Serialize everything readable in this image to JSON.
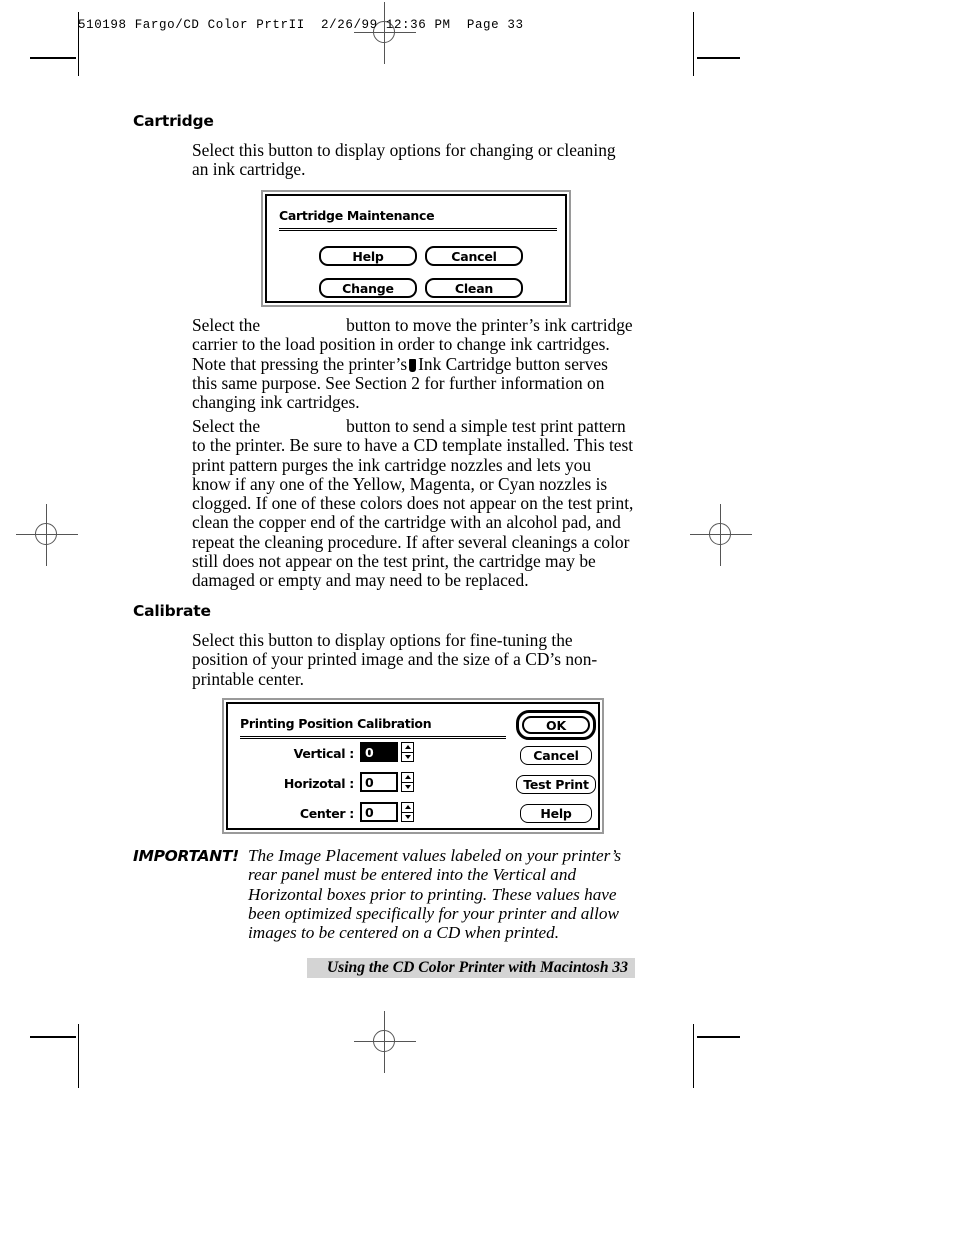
{
  "page_header": {
    "text": "510198 Fargo/CD Color PrtrII  2/26/99 12:36 PM  Page 33"
  },
  "sections": [
    {
      "heading": "Cartridge",
      "intro": "Select this button to display options for changing or cleaning an ink cartridge."
    },
    {
      "heading": "Calibrate",
      "intro": "Select this button to display options for fine-tuning the position of your printed image and the size of a CD’s non-printable center."
    }
  ],
  "paragraphs": {
    "change_para_a": "Select the",
    "change_para_b": "button to move the printer’s ink cartridge carrier to the load position in order to change ink cartridges. Note that pressing the printer’s",
    "change_para_c": "Ink Cartridge button serves this same purpose. See Section 2 for further information on changing ink cartridges.",
    "clean_para_a": "Select the",
    "clean_para_b": "button to send a simple test print pattern to the printer. Be sure to have a CD template installed. This test print pattern purges the ink cartridge nozzles and lets you know if any one of the Yellow, Magenta, or Cyan nozzles is clogged. If one of these colors does not appear on the test print, clean the copper end of the cartridge with an alcohol pad, and repeat the cleaning procedure. If after several cleanings a color still does not appear on the test print, the cartridge may be damaged or empty and may need to be replaced."
  },
  "cartridge_dialog": {
    "title": "Cartridge Maintenance",
    "buttons": [
      {
        "label": "Help"
      },
      {
        "label": "Cancel"
      },
      {
        "label": "Change"
      },
      {
        "label": "Clean"
      }
    ]
  },
  "calibration_dialog": {
    "title": "Printing Position Calibration",
    "fields": [
      {
        "label": "Vertical :",
        "value": "0",
        "selected": true
      },
      {
        "label": "Horizotal :",
        "value": "0",
        "selected": false
      },
      {
        "label": "Center :",
        "value": "0",
        "selected": false
      }
    ],
    "buttons": [
      {
        "label": "OK",
        "default": true
      },
      {
        "label": "Cancel",
        "default": false
      },
      {
        "label": "Test Print",
        "default": false
      },
      {
        "label": "Help",
        "default": false
      }
    ]
  },
  "important_note": {
    "label": "IMPORTANT!",
    "text": "The Image Placement values labeled on your printer’s rear panel must be entered into the Vertical and Horizontal boxes prior to printing. These values have been optimized specifically for your printer and allow images to be centered on a CD when printed."
  },
  "footer": {
    "text": "Using the CD Color Printer with Macintosh 33"
  },
  "colors": {
    "footer_bar": "#d4d4d4",
    "dialog_frame": "#9a9a9a",
    "ink": "#000000",
    "regmark": "#555555"
  }
}
